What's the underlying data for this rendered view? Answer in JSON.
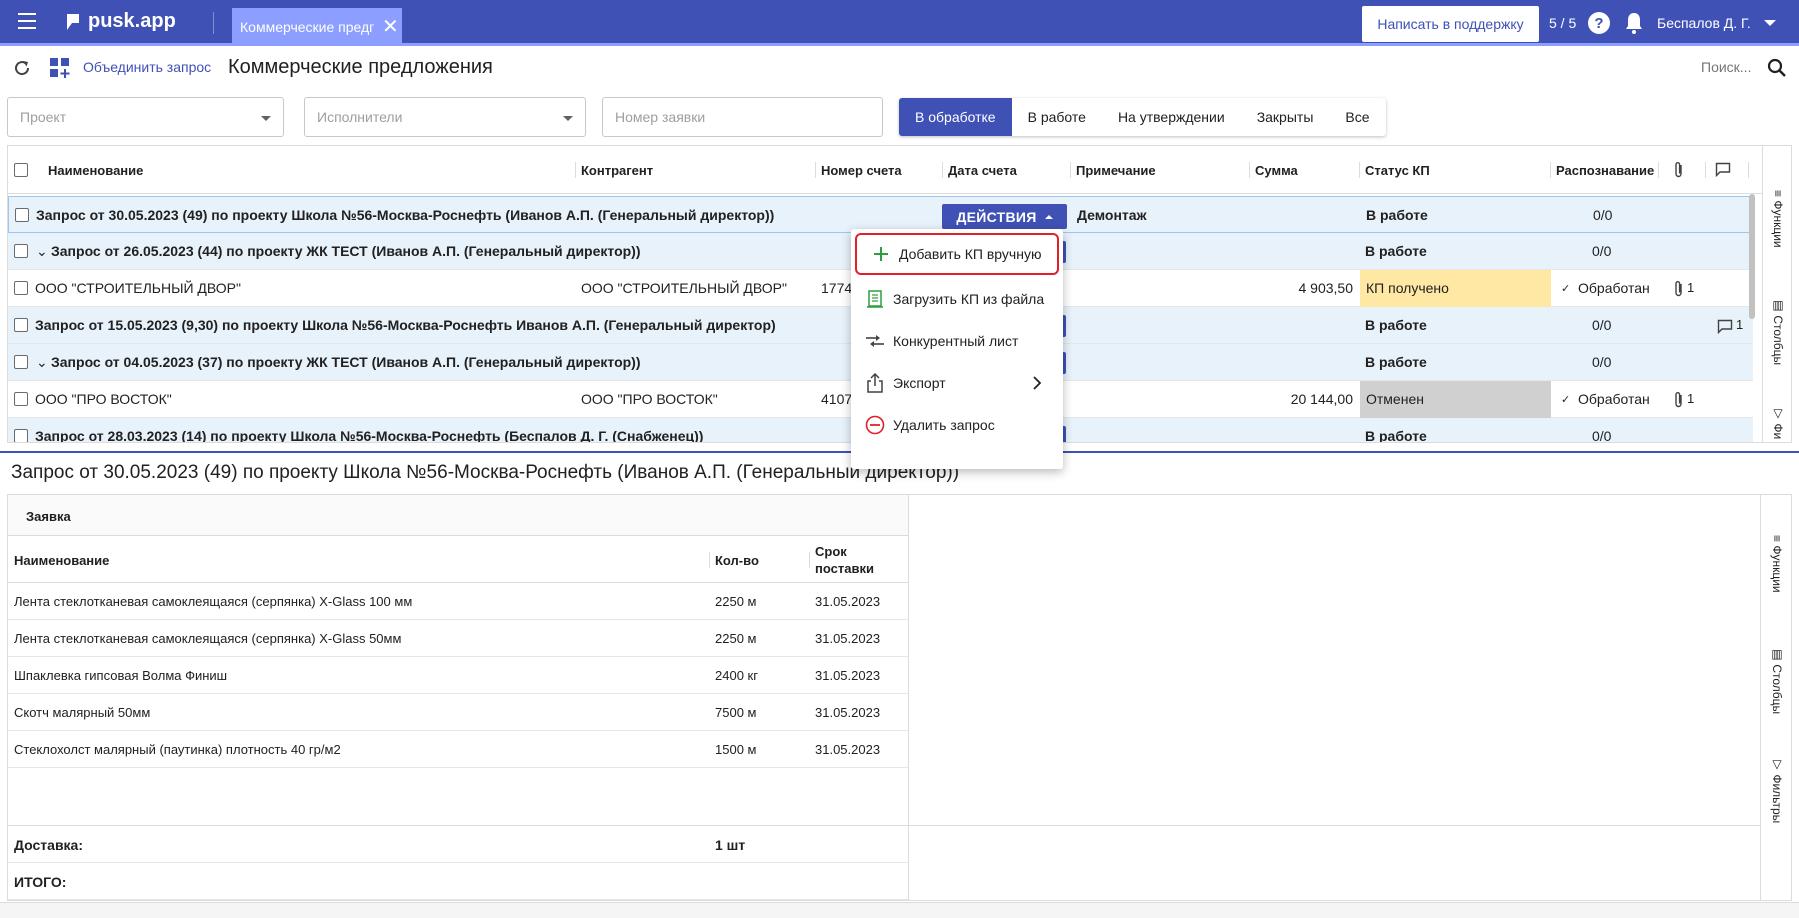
{
  "appbar": {
    "logo": "pusk.app",
    "tab_label": "Коммерческие предг",
    "support_button": "Написать в поддержку",
    "counter": "5 / 5",
    "help": "?",
    "user": "Беспалов Д. Г."
  },
  "toolbar": {
    "merge_link": "Объединить запрос",
    "title": "Коммерческие предложения",
    "search_placeholder": "Поиск..."
  },
  "filters": {
    "project": "Проект",
    "executors": "Исполнители",
    "request_number": "Номер заявки",
    "segments": [
      "В обработке",
      "В работе",
      "На утверждении",
      "Закрыты",
      "Все"
    ],
    "active_segment": "В обработке"
  },
  "grid": {
    "columns": {
      "name": "Наименование",
      "contractor": "Контрагент",
      "invoice_number": "Номер счета",
      "invoice_date": "Дата счета",
      "note": "Примечание",
      "sum": "Сумма",
      "status": "Статус КП",
      "recognition": "Распознавание"
    },
    "rows": [
      {
        "name": "Запрос от 30.05.2023 (49) по проекту Школа №56-Москва-Роснефть (Иванов А.П. (Генеральный директор))",
        "note": "Демонтаж",
        "status": "В работе",
        "recognition": "0/0"
      },
      {
        "toggle": "⌄",
        "name": "Запрос от 26.05.2023 (44) по проекту ЖК ТЕСТ (Иванов А.П. (Генеральный директор))",
        "status": "В работе",
        "recognition": "0/0"
      },
      {
        "name": "ООО \"СТРОИТЕЛЬНЫЙ ДВОР\"",
        "contractor": "ООО \"СТРОИТЕЛЬНЫЙ ДВОР\"",
        "invoice_number": "1774",
        "sum": "4 903,50",
        "status": "КП получено",
        "recognition": "Обработан",
        "attachments": "1"
      },
      {
        "name": "Запрос от 15.05.2023 (9,30) по проекту Школа №56-Москва-Роснефть Иванов А.П. (Генеральный директор)",
        "status": "В работе",
        "recognition": "0/0",
        "comments": "1"
      },
      {
        "toggle": "⌄",
        "name": "Запрос от 04.05.2023 (37) по проекту ЖК ТЕСТ (Иванов А.П. (Генеральный директор))",
        "status": "В работе",
        "recognition": "0/0"
      },
      {
        "name": "ООО \"ПРО ВОСТОК\"",
        "contractor": "ООО \"ПРО ВОСТОК\"",
        "invoice_number": "4107",
        "sum": "20 144,00",
        "status": "Отменен",
        "recognition": "Обработан",
        "attachments": "1"
      },
      {
        "name": "Запрос от 28.03.2023 (14) по проекту Школа №56-Москва-Роснефть (Беспалов Д. Г. (Снабженец))",
        "status": "В работе",
        "recognition": "0/0"
      }
    ],
    "actions_button": "ДЕЙСТВИЯ",
    "side_panel": [
      "Функции",
      "Столбцы",
      "Фи"
    ]
  },
  "actions_menu": {
    "items": [
      "Добавить КП вручную",
      "Загрузить КП из файла",
      "Конкурентный лист",
      "Экспорт",
      "Удалить запрос"
    ],
    "colors": {
      "highlight_border": "#e0202a",
      "add_icon": "#2e9e3e",
      "delete_icon": "#e0202a"
    }
  },
  "detail": {
    "title": "Запрос от 30.05.2023 (49) по проекту Школа №56-Москва-Роснефть (Иванов А.П. (Генеральный директор))",
    "section": "Заявка",
    "columns": {
      "name": "Наименование",
      "qty": "Кол-во",
      "delivery_line1": "Срок",
      "delivery_line2": "поставки"
    },
    "items": [
      {
        "name": "Лента стеклотканевая самоклеящаяся (серпянка) X-Glass 100 мм",
        "qty": "2250 м",
        "date": "31.05.2023"
      },
      {
        "name": "Лента стеклотканевая самоклеящаяся (серпянка) X-Glass 50мм",
        "qty": "2250 м",
        "date": "31.05.2023"
      },
      {
        "name": "Шпаклевка гипсовая Волма Финиш",
        "qty": "2400 кг",
        "date": "31.05.2023"
      },
      {
        "name": "Скотч малярный 50мм",
        "qty": "7500 м",
        "date": "31.05.2023"
      },
      {
        "name": "Стеклохолст малярный (паутинка) плотность 40 гр/м2",
        "qty": "1500 м",
        "date": "31.05.2023"
      }
    ],
    "delivery_label": "Доставка:",
    "delivery_value": "1 шт",
    "total_label": "ИТОГО:",
    "side_panel": [
      "Функции",
      "Столбцы",
      "Фильтры"
    ]
  },
  "colors": {
    "primary": "#3f51b5",
    "tab_active": "#8c9eff",
    "status_received": "#ffe8a3",
    "status_cancelled": "#d0d0d0",
    "group_row": "#e8f2fb"
  }
}
